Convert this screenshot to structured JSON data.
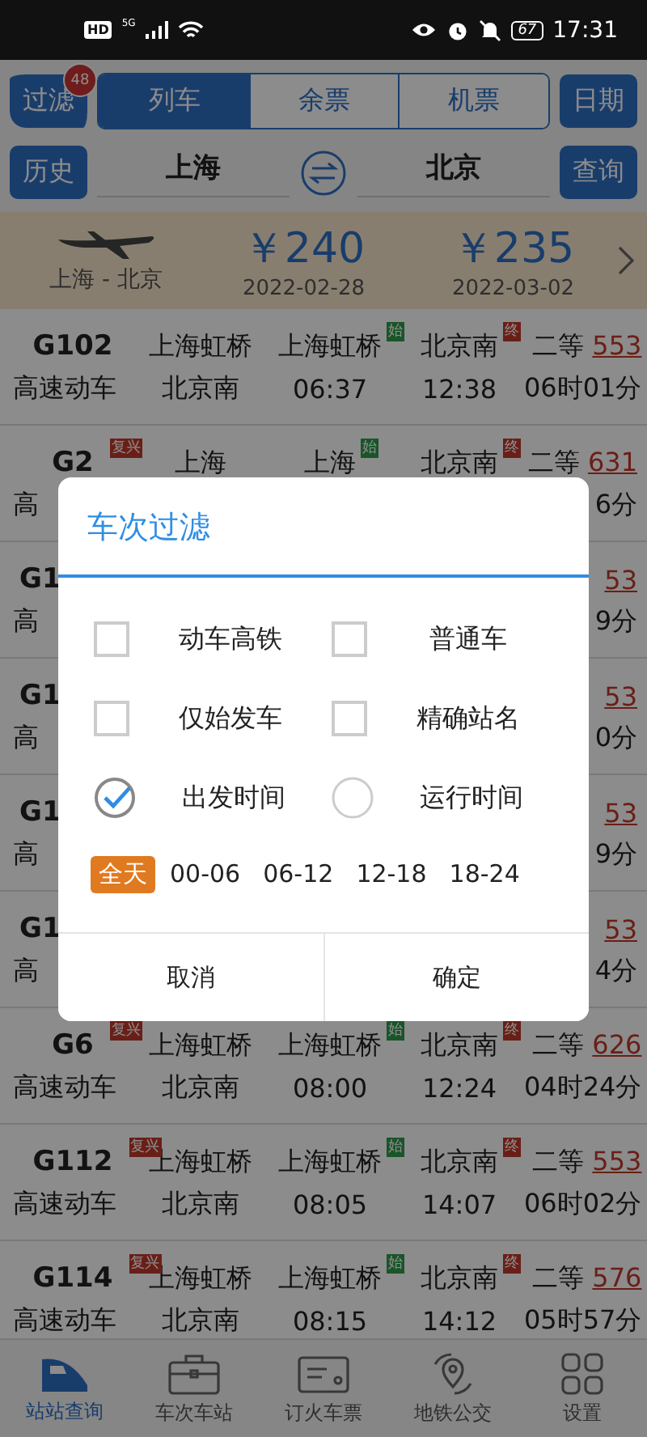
{
  "status_bar": {
    "hd": "HD",
    "network": "5G",
    "battery": "67",
    "time": "17:31"
  },
  "toolbar": {
    "filter_button": {
      "label": "过滤",
      "badge": "48"
    },
    "tabs": [
      {
        "label": "列车",
        "selected": true
      },
      {
        "label": "余票",
        "selected": false
      },
      {
        "label": "机票",
        "selected": false
      }
    ],
    "date_button": "日期"
  },
  "route": {
    "history_button": "历史",
    "from": "上海",
    "to": "北京",
    "query_button": "查询"
  },
  "flight_promo": {
    "route": "上海 - 北京",
    "fares": [
      {
        "price": "￥240",
        "date": "2022-02-28"
      },
      {
        "price": "￥235",
        "date": "2022-03-02"
      }
    ]
  },
  "trains": [
    {
      "covered": false,
      "top": {
        "code": "G102",
        "from": "上海虹桥",
        "dep": "上海虹桥",
        "dep_tag": "始",
        "arr": "北京南",
        "arr_tag": "终",
        "seat_class": "二等",
        "seats": "553"
      },
      "bottom": {
        "type": "高速动车",
        "terminal": "北京南",
        "dep_time": "06:37",
        "arr_time": "12:38",
        "duration": "06时01分"
      }
    },
    {
      "covered": false,
      "top": {
        "code": "G2",
        "badge": "复兴",
        "from": "上海",
        "dep": "上海",
        "dep_tag": "始",
        "arr": "北京南",
        "arr_tag": "终",
        "seat_class": "二等",
        "seats": "631"
      },
      "bottom": {
        "type": "高",
        "duration": "6分"
      }
    },
    {
      "covered": true,
      "top": {
        "code": "G1",
        "seats": "53"
      },
      "bottom": {
        "type": "高",
        "duration": "9分"
      }
    },
    {
      "covered": true,
      "top": {
        "code": "G1",
        "seats": "53"
      },
      "bottom": {
        "type": "高",
        "duration": "0分"
      }
    },
    {
      "covered": true,
      "top": {
        "code": "G1",
        "seats": "53"
      },
      "bottom": {
        "type": "高",
        "duration": "9分"
      }
    },
    {
      "covered": true,
      "top": {
        "code": "G1",
        "seats": "53"
      },
      "bottom": {
        "type": "高",
        "duration": "4分"
      }
    },
    {
      "covered": false,
      "top": {
        "code": "G6",
        "badge": "复兴",
        "from": "上海虹桥",
        "dep": "上海虹桥",
        "dep_tag": "始",
        "arr": "北京南",
        "arr_tag": "终",
        "seat_class": "二等",
        "seats": "626"
      },
      "bottom": {
        "type": "高速动车",
        "terminal": "北京南",
        "dep_time": "08:00",
        "arr_time": "12:24",
        "duration": "04时24分"
      }
    },
    {
      "covered": false,
      "top": {
        "code": "G112",
        "badge": "复兴",
        "from": "上海虹桥",
        "dep": "上海虹桥",
        "dep_tag": "始",
        "arr": "北京南",
        "arr_tag": "终",
        "seat_class": "二等",
        "seats": "553"
      },
      "bottom": {
        "type": "高速动车",
        "terminal": "北京南",
        "dep_time": "08:05",
        "arr_time": "14:07",
        "duration": "06时02分"
      }
    },
    {
      "covered": false,
      "top": {
        "code": "G114",
        "badge": "复兴",
        "from": "上海虹桥",
        "dep": "上海虹桥",
        "dep_tag": "始",
        "arr": "北京南",
        "arr_tag": "终",
        "seat_class": "二等",
        "seats": "576"
      },
      "bottom": {
        "type": "高速动车",
        "terminal": "北京南",
        "dep_time": "08:15",
        "arr_time": "14:12",
        "duration": "05时57分"
      }
    }
  ],
  "dialog": {
    "title": "车次过滤",
    "options": [
      {
        "label": "动车高铁",
        "kind": "checkbox",
        "checked": false
      },
      {
        "label": "普通车",
        "kind": "checkbox",
        "checked": false
      },
      {
        "label": "仅始发车",
        "kind": "checkbox",
        "checked": false
      },
      {
        "label": "精确站名",
        "kind": "checkbox",
        "checked": false
      },
      {
        "label": "出发时间",
        "kind": "radio",
        "checked": true
      },
      {
        "label": "运行时间",
        "kind": "radio",
        "checked": false
      }
    ],
    "time_ranges": [
      {
        "label": "全天",
        "selected": true
      },
      {
        "label": "00-06",
        "selected": false
      },
      {
        "label": "06-12",
        "selected": false
      },
      {
        "label": "12-18",
        "selected": false
      },
      {
        "label": "18-24",
        "selected": false
      }
    ],
    "buttons": [
      "取消",
      "确定"
    ]
  },
  "bottom_nav": [
    {
      "label": "站站查询",
      "selected": true
    },
    {
      "label": "车次车站",
      "selected": false
    },
    {
      "label": "订火车票",
      "selected": false
    },
    {
      "label": "地铁公交",
      "selected": false
    },
    {
      "label": "设置",
      "selected": false
    }
  ]
}
